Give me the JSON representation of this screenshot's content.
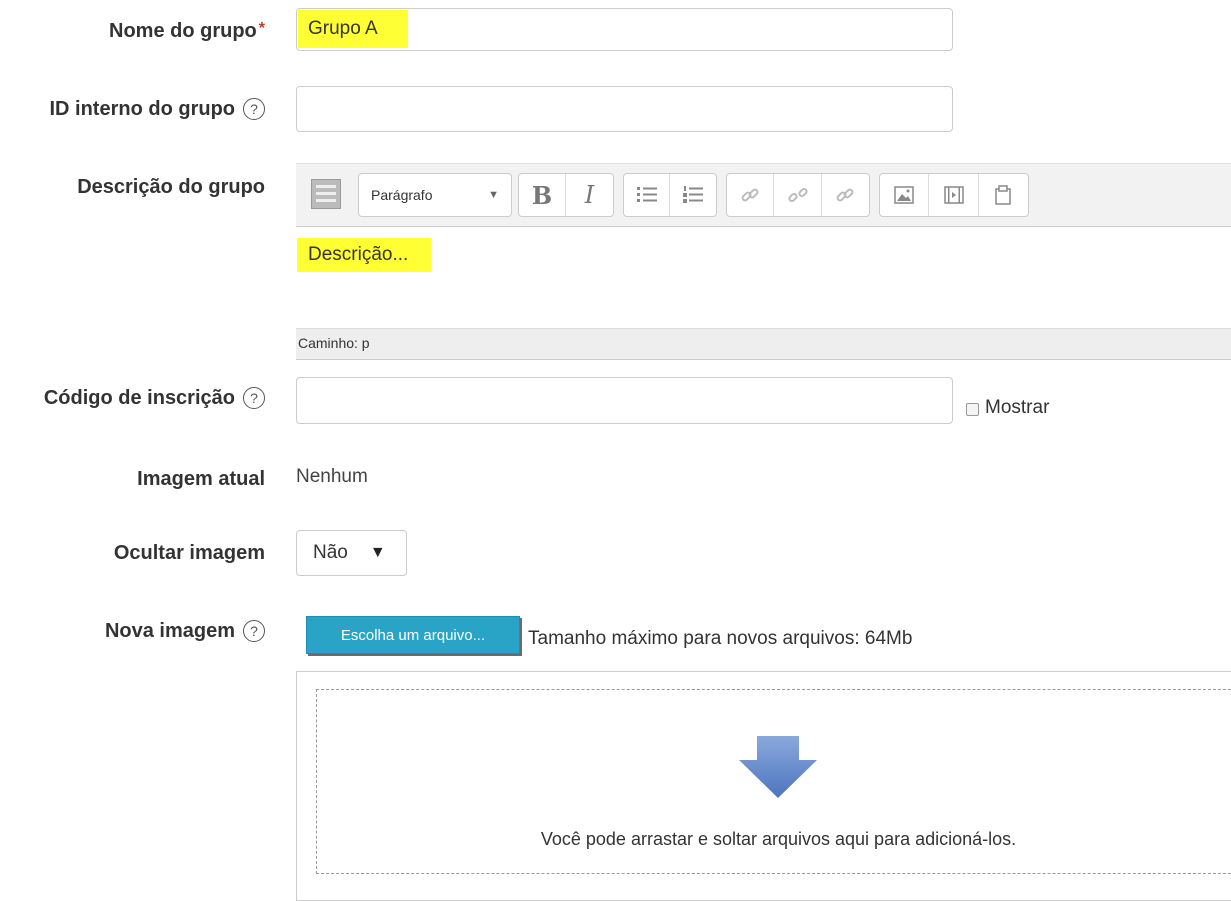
{
  "fields": {
    "group_name": {
      "label": "Nome do grupo",
      "required_marker": "*",
      "value": "Grupo A"
    },
    "group_id": {
      "label": "ID interno do grupo",
      "value": ""
    },
    "description": {
      "label": "Descrição do grupo",
      "format_select": "Parágrafo",
      "content": "Descrição...",
      "path": "Caminho: p"
    },
    "enrolment_key": {
      "label": "Código de inscrição",
      "value": "",
      "show_label": "Mostrar"
    },
    "current_image": {
      "label": "Imagem atual",
      "value": "Nenhum"
    },
    "hide_image": {
      "label": "Ocultar imagem",
      "selected": "Não"
    },
    "new_image": {
      "label": "Nova imagem",
      "choose_button": "Escolha um arquivo...",
      "max_size": "Tamanho máximo para novos arquivos: 64Mb",
      "drop_text": "Você pode arrastar e soltar arquivos aqui para adicioná-los."
    }
  },
  "icons": {
    "help": "question-circle-icon",
    "toolbar": [
      "collapse-toolbar-icon",
      "bold-icon",
      "italic-icon",
      "unordered-list-icon",
      "ordered-list-icon",
      "link-icon",
      "unlink-icon",
      "manage-links-icon",
      "image-icon",
      "media-icon",
      "manage-files-icon"
    ],
    "drop_arrow": "arrow-down-icon"
  },
  "colors": {
    "highlight": "#ffff33",
    "required": "#c0392b",
    "file_button": "#29a4c6",
    "drop_arrow": "#5b83c7"
  }
}
